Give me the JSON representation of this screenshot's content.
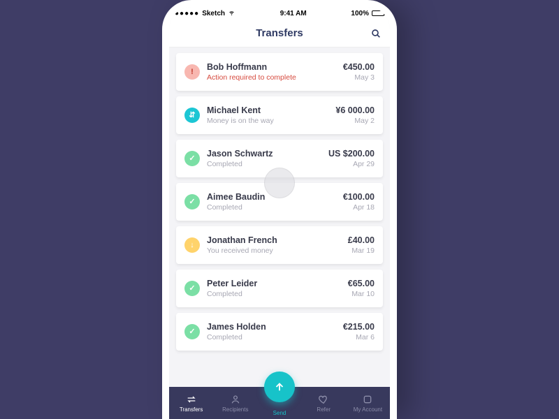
{
  "status_bar": {
    "carrier": "Sketch",
    "time": "9:41 AM",
    "battery_pct": "100%"
  },
  "header": {
    "title": "Transfers"
  },
  "transfers": [
    {
      "name": "Bob Hoffmann",
      "status": "Action required to complete",
      "status_kind": "alert",
      "amount": "€450.00",
      "date": "May 3"
    },
    {
      "name": "Michael Kent",
      "status": "Money is on the way",
      "status_kind": "transit",
      "amount": "¥6 000.00",
      "date": "May 2"
    },
    {
      "name": "Jason Schwartz",
      "status": "Completed",
      "status_kind": "done",
      "amount": "US $200.00",
      "date": "Apr 29"
    },
    {
      "name": "Aimee Baudin",
      "status": "Completed",
      "status_kind": "done",
      "amount": "€100.00",
      "date": "Apr 18"
    },
    {
      "name": "Jonathan French",
      "status": "You received money",
      "status_kind": "recv",
      "amount": "£40.00",
      "date": "Mar 19"
    },
    {
      "name": "Peter Leider",
      "status": "Completed",
      "status_kind": "done",
      "amount": "€65.00",
      "date": "Mar 10"
    },
    {
      "name": "James Holden",
      "status": "Completed",
      "status_kind": "done",
      "amount": "€215.00",
      "date": "Mar 6"
    }
  ],
  "tabs": {
    "transfers": "Transfers",
    "recipients": "Recipients",
    "send": "Send",
    "refer": "Refer",
    "account": "My Account"
  }
}
